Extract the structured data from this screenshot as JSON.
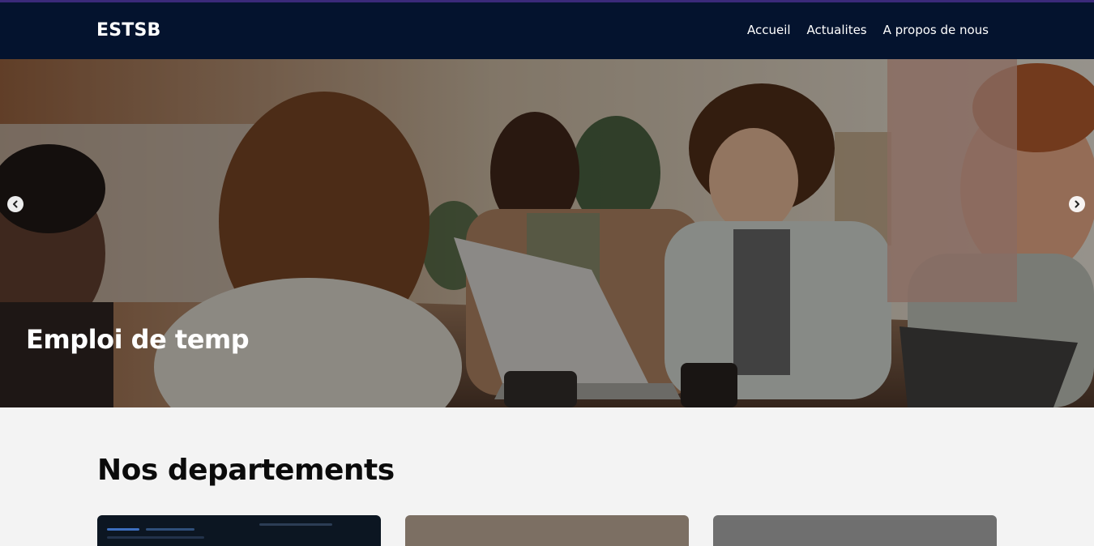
{
  "header": {
    "brand": "ESTSB",
    "nav": [
      {
        "label": "Accueil"
      },
      {
        "label": "Actualites"
      },
      {
        "label": "A propos de nous"
      }
    ]
  },
  "hero": {
    "caption": "Emploi de temp",
    "prev_icon": "chevron-left-icon",
    "next_icon": "chevron-right-icon"
  },
  "departments": {
    "title": "Nos departements"
  },
  "colors": {
    "navbar": "#04132e",
    "accent_line": "#3b2a7a",
    "page_bg": "#f3f3f3"
  }
}
